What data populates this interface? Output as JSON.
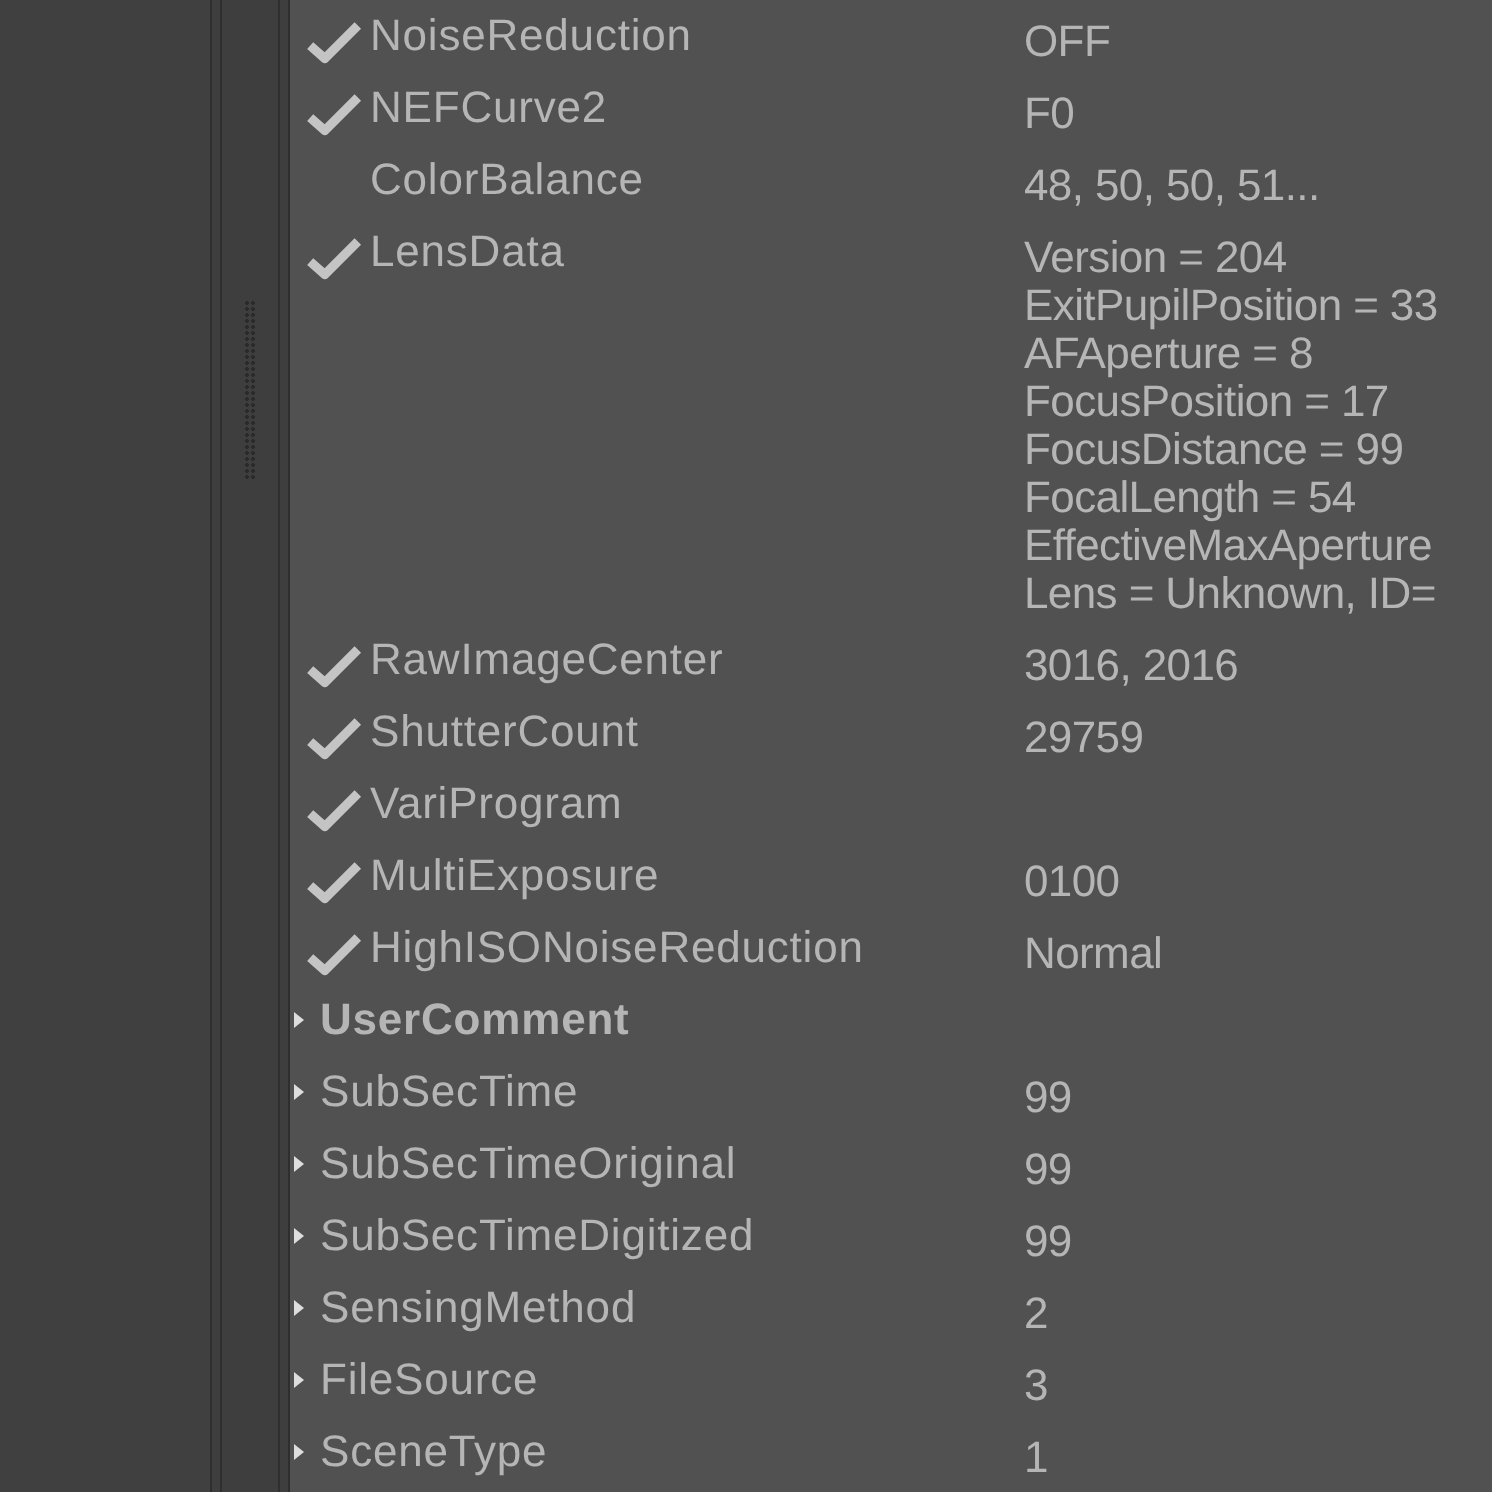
{
  "rows": [
    {
      "kind": "child",
      "name": "NoiseReduction",
      "checked": true,
      "value": [
        "OFF"
      ]
    },
    {
      "kind": "child",
      "name": "NEFCurve2",
      "checked": true,
      "value": [
        "F0"
      ]
    },
    {
      "kind": "child",
      "name": "ColorBalance",
      "checked": false,
      "value": [
        "48, 50, 50, 51..."
      ]
    },
    {
      "kind": "child",
      "name": "LensData",
      "checked": true,
      "value": [
        "Version = 204",
        "ExitPupilPosition = 33",
        "AFAperture = 8",
        "FocusPosition = 17",
        "FocusDistance = 99",
        "FocalLength = 54",
        "EffectiveMaxAperture",
        "Lens = Unknown, ID="
      ]
    },
    {
      "kind": "child",
      "name": "RawImageCenter",
      "checked": true,
      "value": [
        "3016, 2016"
      ]
    },
    {
      "kind": "child",
      "name": "ShutterCount",
      "checked": true,
      "value": [
        "29759"
      ]
    },
    {
      "kind": "child",
      "name": "VariProgram",
      "checked": true,
      "value": []
    },
    {
      "kind": "child",
      "name": "MultiExposure",
      "checked": true,
      "value": [
        "0100"
      ]
    },
    {
      "kind": "child",
      "name": "HighISONoiseReduction",
      "checked": true,
      "value": [
        "Normal"
      ]
    },
    {
      "kind": "group",
      "name": "UserComment",
      "emphasized": true,
      "value": []
    },
    {
      "kind": "group",
      "name": "SubSecTime",
      "emphasized": false,
      "value": [
        "99"
      ]
    },
    {
      "kind": "group",
      "name": "SubSecTimeOriginal",
      "emphasized": false,
      "value": [
        "99"
      ]
    },
    {
      "kind": "group",
      "name": "SubSecTimeDigitized",
      "emphasized": false,
      "value": [
        "99"
      ]
    },
    {
      "kind": "group",
      "name": "SensingMethod",
      "emphasized": false,
      "value": [
        "2"
      ]
    },
    {
      "kind": "group",
      "name": "FileSource",
      "emphasized": false,
      "value": [
        "3"
      ]
    },
    {
      "kind": "group",
      "name": "SceneType",
      "emphasized": false,
      "value": [
        "1"
      ]
    }
  ]
}
